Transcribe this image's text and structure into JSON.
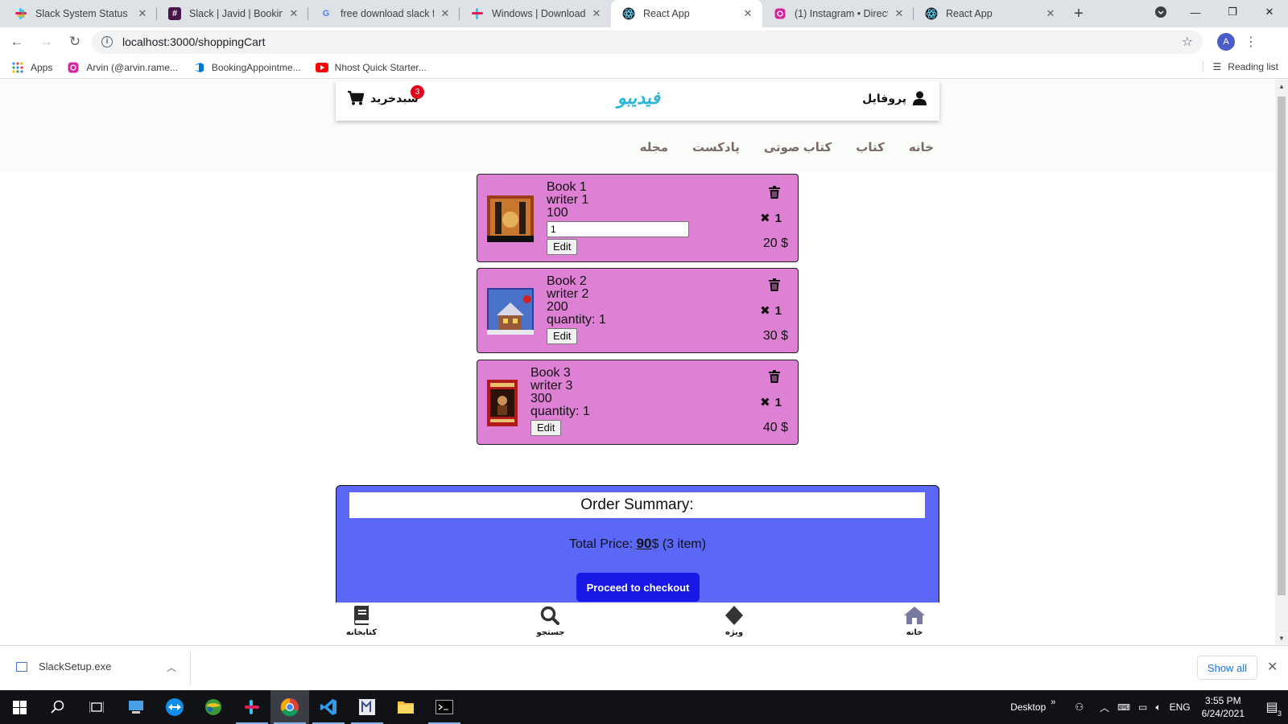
{
  "browser": {
    "tabs": [
      {
        "title": "Slack System Status",
        "icon": "slack-icon",
        "active": false
      },
      {
        "title": "Slack | Javid | BookingAp",
        "icon": "slack-workspace-icon",
        "active": false
      },
      {
        "title": "free download slack for",
        "icon": "google-icon",
        "active": false
      },
      {
        "title": "Windows | Downloads |",
        "icon": "slack-icon",
        "active": false
      },
      {
        "title": "React App",
        "icon": "react-icon",
        "active": true
      },
      {
        "title": "(1) Instagram • Direct",
        "icon": "instagram-icon",
        "active": false
      },
      {
        "title": "React App",
        "icon": "react-icon",
        "active": false
      }
    ],
    "url": "localhost:3000/shoppingCart",
    "profile_initial": "A",
    "bookmarks": [
      {
        "label": "Apps",
        "icon": "apps-grid-icon"
      },
      {
        "label": "Arvin (@arvin.rame...",
        "icon": "instagram-icon"
      },
      {
        "label": "BookingAppointme...",
        "icon": "azure-devops-icon"
      },
      {
        "label": "Nhost Quick Starter...",
        "icon": "youtube-icon"
      }
    ],
    "reading_list": "Reading list"
  },
  "header": {
    "cart_label": "سبدخرید",
    "cart_count": "3",
    "logo": "فیدیبو",
    "profile_label": "پروفایل"
  },
  "nav": {
    "items": [
      "خانه",
      "کتاب",
      "کتاب صوتی",
      "پادکست",
      "مجله"
    ]
  },
  "cart_items": [
    {
      "title": "Book 1",
      "writer": "writer 1",
      "price": "100",
      "input_value": "1",
      "quantity_text": "",
      "edit_label": "Edit",
      "multiplier": "1",
      "line_total": "20 $"
    },
    {
      "title": "Book 2",
      "writer": "writer 2",
      "price": "200",
      "input_value": "",
      "quantity_text": "quantity: 1",
      "edit_label": "Edit",
      "multiplier": "1",
      "line_total": "30 $"
    },
    {
      "title": "Book 3",
      "writer": "writer 3",
      "price": "300",
      "input_value": "",
      "quantity_text": "quantity: 1",
      "edit_label": "Edit",
      "multiplier": "1",
      "line_total": "40 $"
    }
  ],
  "summary": {
    "title": "Order Summary:",
    "total_prefix": "Total Price: ",
    "total_value": "90",
    "total_suffix": "$ (3 item)",
    "checkout_label": "Proceed to checkout"
  },
  "bottom_nav": [
    {
      "label": "کتابخانه",
      "icon": "library-icon"
    },
    {
      "label": "جستجو",
      "icon": "search-icon"
    },
    {
      "label": "ویژه",
      "icon": "diamond-icon"
    },
    {
      "label": "خانه",
      "icon": "home-icon"
    }
  ],
  "downloads": {
    "file": "SlackSetup.exe",
    "show_all": "Show all"
  },
  "taskbar": {
    "desktop_label": "Desktop",
    "language": "ENG",
    "time": "3:55 PM",
    "date": "6/24/2021",
    "notification_count": "3"
  },
  "colors": {
    "card_bg": "#de80d4",
    "summary_bg": "#5a67f7",
    "checkout_bg": "#1a18e6",
    "badge": "#e3001b",
    "logo": "#29b6d8"
  }
}
